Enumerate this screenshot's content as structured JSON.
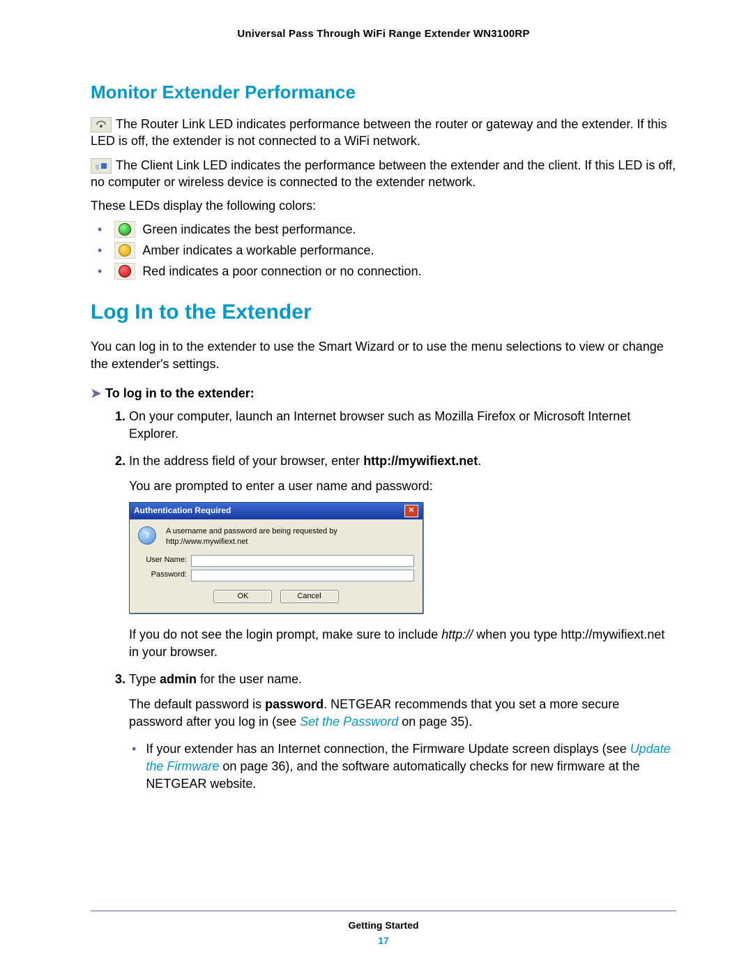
{
  "doc_title": "Universal Pass Through WiFi Range Extender WN3100RP",
  "section1": {
    "heading": "Monitor Extender Performance",
    "router_link_text": "The Router Link LED indicates performance between the router or gateway and the extender. If this LED is off, the extender is not connected to a WiFi network.",
    "client_link_text": "The Client Link LED indicates the performance between the extender and the client. If this LED is off, no computer or wireless device is connected to the extender network.",
    "led_intro": "These LEDs display the following colors:",
    "leds": [
      {
        "text": "Green indicates the best performance."
      },
      {
        "text": "Amber indicates a workable performance."
      },
      {
        "text": "Red indicates a poor connection or no connection."
      }
    ]
  },
  "section2": {
    "heading": "Log In to the Extender",
    "intro": "You can log in to the extender to use the Smart Wizard or to use the menu selections to view or change the extender's settings.",
    "task_title": "To log in to the extender:",
    "step1": "On your computer, launch an Internet browser such as Mozilla Firefox or Microsoft Internet Explorer.",
    "step2_a": "In the address field of your browser, enter ",
    "step2_url": "http://mywifiext.net",
    "step2_b": ".",
    "step2_prompt": "You are prompted to enter a user name and password:",
    "dialog": {
      "title": "Authentication Required",
      "message": "A username and password are being requested by http://www.mywifiext.net",
      "username_label": "User Name:",
      "password_label": "Password:",
      "username_value": "",
      "password_value": "",
      "ok": "OK",
      "cancel": "Cancel"
    },
    "step2_after_a": "If you do not see the login prompt, make sure to include ",
    "step2_after_http": "http://",
    "step2_after_b": " when you type http://mywifiext.net in your browser.",
    "step3_a": "Type ",
    "step3_admin": "admin",
    "step3_b": " for the user name.",
    "step3_pw_a": "The default password is ",
    "step3_pw_word": "password",
    "step3_pw_b": ". NETGEAR recommends that you set a more secure password after you log in (see ",
    "step3_pw_link": "Set the Password",
    "step3_pw_c": " on page 35).",
    "step3_bullet_a": "If your extender has an Internet connection, the Firmware Update screen displays (see ",
    "step3_bullet_link": "Update the Firmware",
    "step3_bullet_b": " on page 36), and the software automatically checks for new firmware at the NETGEAR website."
  },
  "footer": {
    "chapter": "Getting Started",
    "page": "17"
  }
}
